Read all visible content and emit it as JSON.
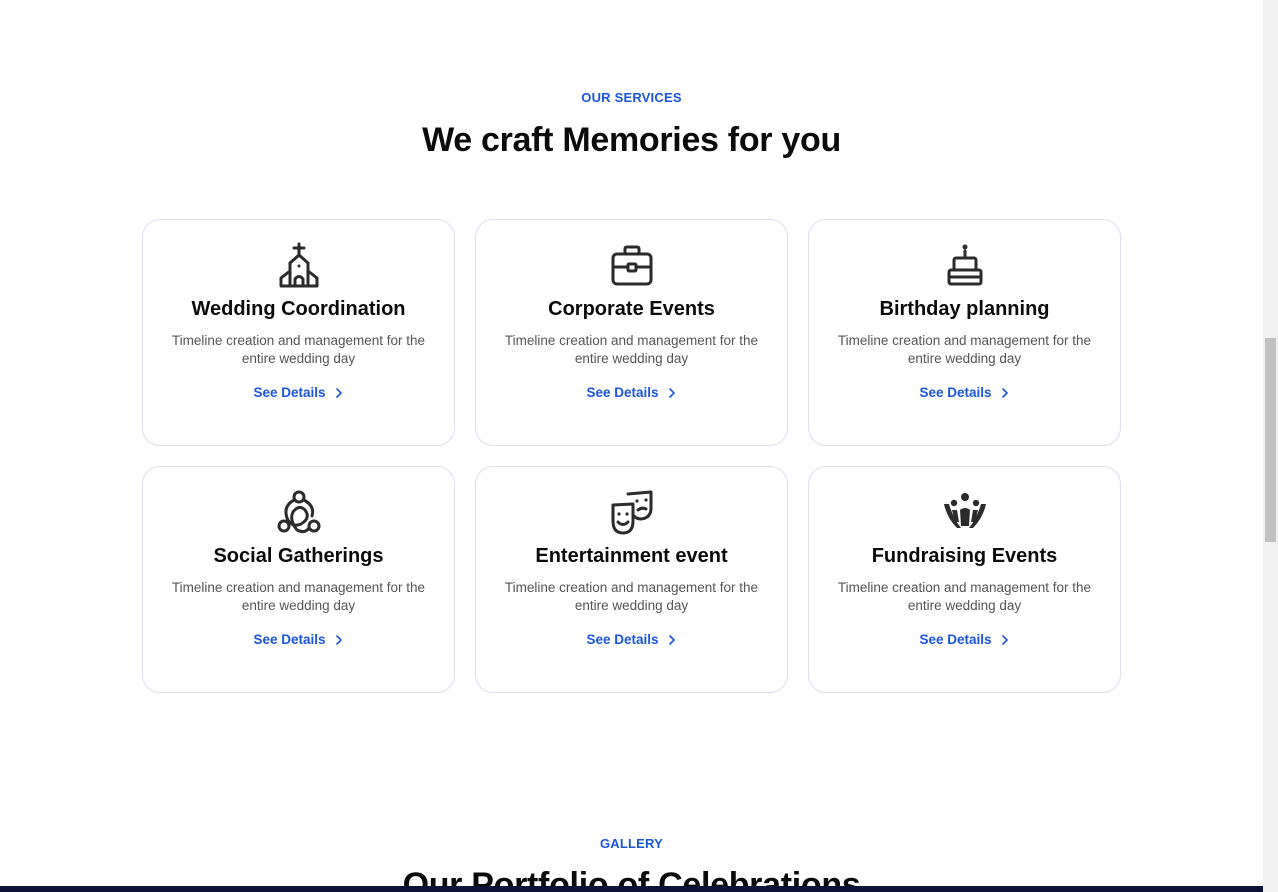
{
  "services": {
    "eyebrow": "OUR SERVICES",
    "title": "We craft Memories for you",
    "cards": [
      {
        "icon": "church-icon",
        "title": "Wedding Coordination",
        "description": "Timeline creation and management for the entire wedding day",
        "link": "See Details"
      },
      {
        "icon": "briefcase-icon",
        "title": "Corporate Events",
        "description": "Timeline creation and management for the entire wedding day",
        "link": "See Details"
      },
      {
        "icon": "cake-icon",
        "title": "Birthday planning",
        "description": "Timeline creation and management for the entire wedding day",
        "link": "See Details"
      },
      {
        "icon": "people-network-icon",
        "title": "Social Gatherings",
        "description": "Timeline creation and management for the entire wedding day",
        "link": "See Details"
      },
      {
        "icon": "theater-masks-icon",
        "title": "Entertainment event",
        "description": "Timeline creation and management for the entire wedding day",
        "link": "See Details"
      },
      {
        "icon": "raised-hands-icon",
        "title": "Fundraising Events",
        "description": "Timeline creation and management for the entire wedding day",
        "link": "See Details"
      }
    ]
  },
  "gallery": {
    "eyebrow": "GALLERY",
    "title": "Our Portfolio of Celebrations"
  },
  "colors": {
    "accent": "#1a56db",
    "card_border": "#dcdcf2",
    "icon": "#2b2b2b"
  }
}
